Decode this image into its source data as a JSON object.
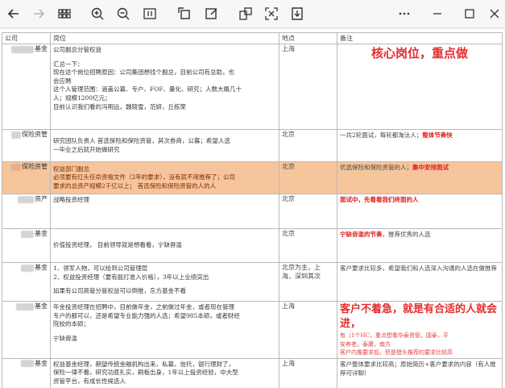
{
  "toolbar": {
    "icons": [
      "back-arrow-icon",
      "forward-arrow-icon",
      "thumbnails-icon",
      "zoom-in-icon",
      "zoom-out-icon",
      "fit-page-icon",
      "rotate-icon",
      "annotate-icon",
      "extract-icon",
      "screenshot-icon",
      "download-icon",
      "more-icon",
      "minimize-icon",
      "maximize-icon",
      "close-icon"
    ]
  },
  "table": {
    "headers": [
      "公司",
      "岗位",
      "地点",
      "备注"
    ],
    "rows": [
      {
        "company": "基金",
        "position": [
          "公司副总分管权益",
          "",
          "汇总一下：",
          "现在这个岗位招聘原因：公司集团想找个副总，目前公司有总助，也",
          "会应聘",
          "这个人管理范围：涵盖公募、专户、FOF、量化、研究；人数大概几十",
          "人；规模1200亿元；",
          "目前认识我们看的冯明远，魏晓雪，范妍，丘栋荣"
        ],
        "location": [
          "上海"
        ],
        "note": "核心岗位，重点做"
      },
      {
        "company": "保险资管",
        "position": [
          "研究团队负责人    首选保险和保险资管，其次券商，公募；希望人选",
          "一毕业之后就开始做研究"
        ],
        "location": [
          "北京"
        ],
        "note_plain": "一共2轮面试，每轮都淘汰人；",
        "note_red": "整体节奏快"
      },
      {
        "company": "保险资管",
        "position": [
          "权益部门副总",
          "必须要有红头任命资格文件（2年的要求），没有就不用推荐了；公司",
          "要求的总资产规模2千亿以上；    首选保险和保险资管的人的人"
        ],
        "location": [
          "北京"
        ],
        "note_plain": "优选保险和保险资管的人；",
        "note_red": "集中安排面试"
      },
      {
        "company": "资产",
        "position": [
          "战略投资经理"
        ],
        "location": [
          "北京"
        ],
        "note_red": "面试中，先看看我们终面的人"
      },
      {
        "company": "基金",
        "position": [
          "价值投资经理，    目前领导就是想看看，宁缺毋滥"
        ],
        "location": [
          "北京"
        ],
        "note_red": "宁缺毋滥的节奏",
        "note_plain": "，推荐优秀的人选"
      },
      {
        "company": "基金",
        "position": [
          "1、领军人物，可以给到公司管理层",
          "2、权益投资经理（要有能打准入价格），3年以上业绩突出",
          "",
          "如果有公司高管分管权益可以倒推，东方基金不看"
        ],
        "location": [
          "北京为主，上",
          "海，深圳其次"
        ],
        "note": "客户要求比较多，希望我们和人选深入沟通的人选在做推荐"
      },
      {
        "company": "基金",
        "position": [
          "年金投资经理在招聘中，目前做年金，之前做过年金，或者现在管理",
          "专户的都可以，还是希望专业能力强的人选；希望985本硕，或者财经",
          "院校的本硕；",
          "",
          "宁缺毋滥"
        ],
        "location": [
          "上海"
        ],
        "note": "客户不着急，就是有合适的人就会进，",
        "note_red_lines": [
          "有（1个HC，重点想看华泰资管，国泰，平",
          "安养老，泰康，南方",
          "客户内推要求低，但是猎头推荐的要求比较高"
        ]
      },
      {
        "company": "基金",
        "position": [
          "权益基金经理，期望传统金融机构出来，私募，信托，银行理财了，",
          "保险一律不看，研究功底扎实，刷板出身，1年以上投资经验，中大型",
          "资管平台，有成长性候选人"
        ],
        "location": [
          "上海"
        ],
        "note": "客户整体要求比较高；原始简历+客户要求的内容（有人推荐可详聊）"
      }
    ]
  },
  "colors": {
    "highlight": "#f7c59b",
    "accent_red": "#e02020"
  }
}
